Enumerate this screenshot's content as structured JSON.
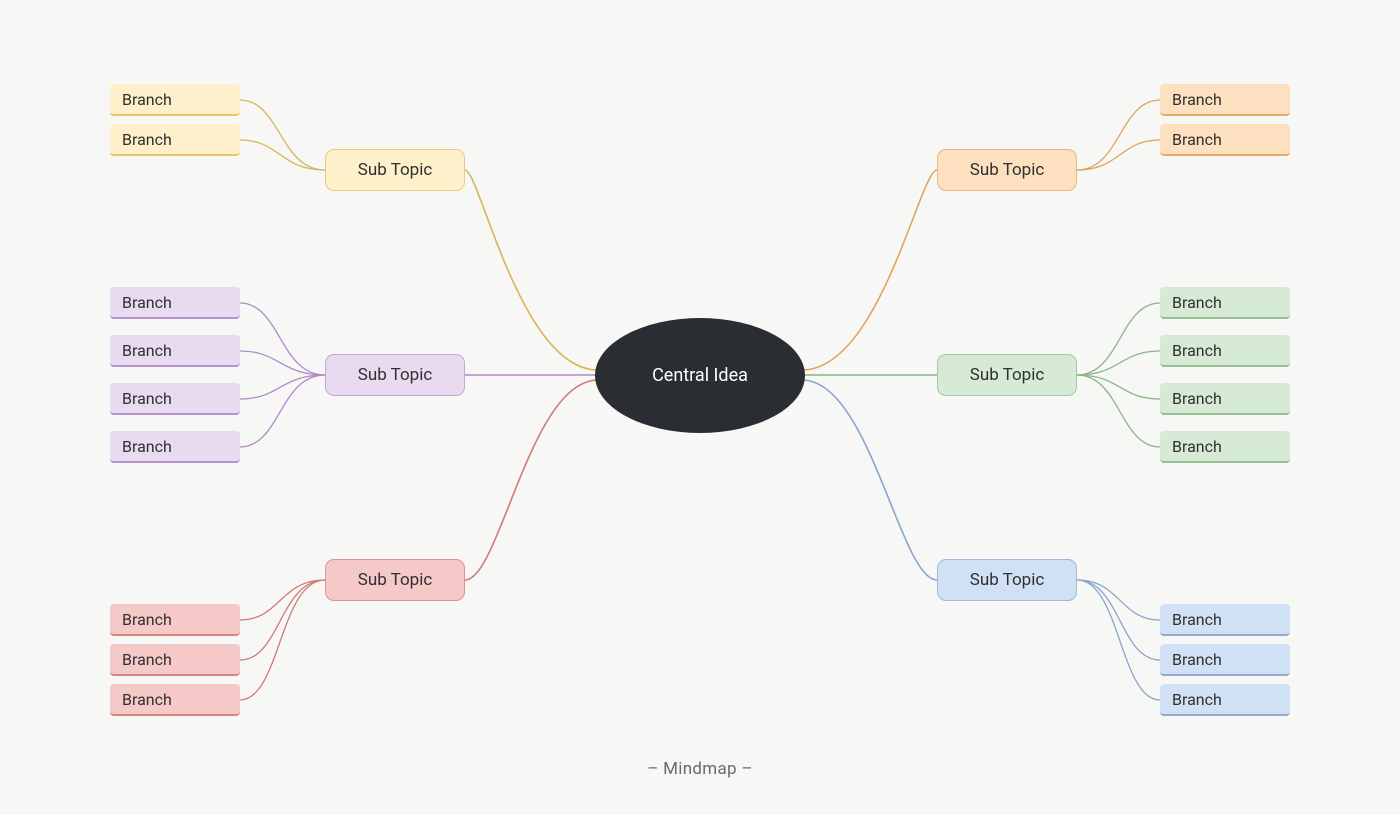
{
  "caption": "– Mindmap –",
  "central": {
    "label": "Central Idea"
  },
  "subtopics": {
    "tl": {
      "label": "Sub Topic",
      "color": "yellow",
      "stroke": "#d8b558",
      "branches": [
        {
          "label": "Branch"
        },
        {
          "label": "Branch"
        }
      ]
    },
    "ml": {
      "label": "Sub Topic",
      "color": "purple",
      "stroke": "#b08ac7",
      "branches": [
        {
          "label": "Branch"
        },
        {
          "label": "Branch"
        },
        {
          "label": "Branch"
        },
        {
          "label": "Branch"
        }
      ]
    },
    "bl": {
      "label": "Sub Topic",
      "color": "red",
      "stroke": "#cf7b77",
      "branches": [
        {
          "label": "Branch"
        },
        {
          "label": "Branch"
        },
        {
          "label": "Branch"
        }
      ]
    },
    "tr": {
      "label": "Sub Topic",
      "color": "orange",
      "stroke": "#dea55b",
      "branches": [
        {
          "label": "Branch"
        },
        {
          "label": "Branch"
        }
      ]
    },
    "mr": {
      "label": "Sub Topic",
      "color": "green",
      "stroke": "#8ab68a",
      "branches": [
        {
          "label": "Branch"
        },
        {
          "label": "Branch"
        },
        {
          "label": "Branch"
        },
        {
          "label": "Branch"
        }
      ]
    },
    "br": {
      "label": "Sub Topic",
      "color": "blue",
      "stroke": "#8aa6cc",
      "branches": [
        {
          "label": "Branch"
        },
        {
          "label": "Branch"
        },
        {
          "label": "Branch"
        }
      ]
    }
  }
}
